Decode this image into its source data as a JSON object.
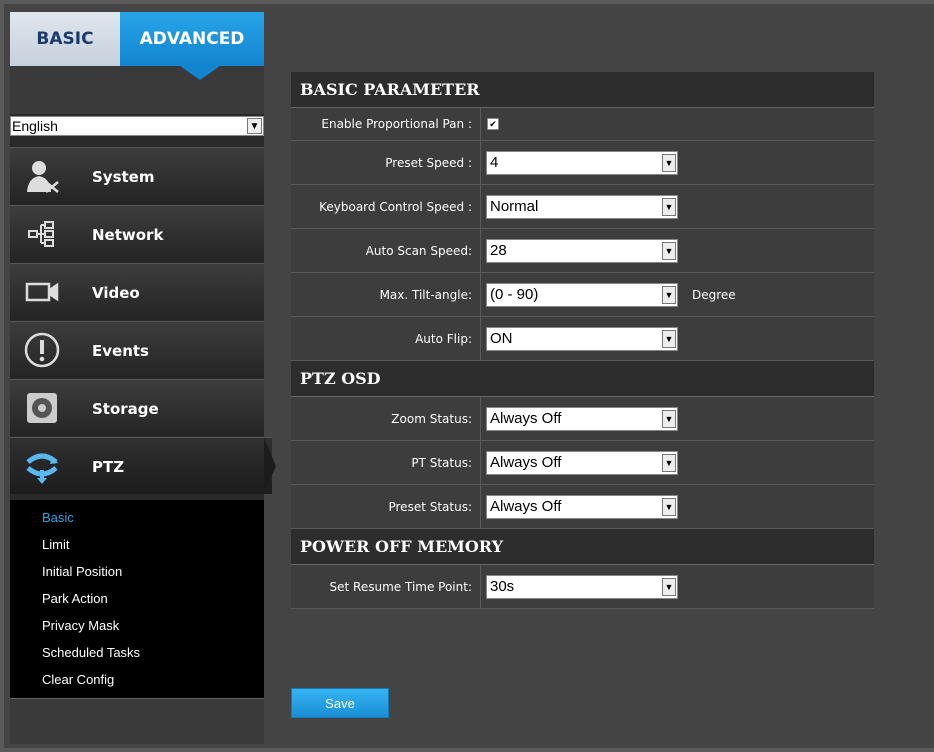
{
  "tabs": {
    "basic": "BASIC",
    "advanced": "ADVANCED"
  },
  "language": {
    "selected": "English"
  },
  "menu": [
    {
      "label": "System",
      "icon": "user-tools-icon"
    },
    {
      "label": "Network",
      "icon": "network-icon"
    },
    {
      "label": "Video",
      "icon": "video-camera-icon"
    },
    {
      "label": "Events",
      "icon": "alert-icon"
    },
    {
      "label": "Storage",
      "icon": "storage-disk-icon"
    },
    {
      "label": "PTZ",
      "icon": "ptz-icon"
    }
  ],
  "submenu": [
    "Basic",
    "Limit",
    "Initial Position",
    "Park Action",
    "Privacy Mask",
    "Scheduled Tasks",
    "Clear Config"
  ],
  "sections": {
    "basic_parameter": {
      "title": "BASIC PARAMETER",
      "enable_pan_label": "Enable Proportional Pan :",
      "enable_pan_checked": "✔",
      "preset_speed_label": "Preset Speed :",
      "preset_speed_value": "4",
      "keyboard_speed_label": "Keyboard Control Speed :",
      "keyboard_speed_value": "Normal",
      "auto_scan_label": "Auto Scan Speed:",
      "auto_scan_value": "28",
      "tilt_label": "Max. Tilt-angle:",
      "tilt_value": "(0 - 90)",
      "tilt_unit": "Degree",
      "auto_flip_label": "Auto Flip:",
      "auto_flip_value": "ON"
    },
    "ptz_osd": {
      "title": "PTZ OSD",
      "zoom_label": "Zoom Status:",
      "zoom_value": "Always Off",
      "pt_label": "PT Status:",
      "pt_value": "Always Off",
      "preset_label": "Preset Status:",
      "preset_value": "Always Off"
    },
    "power_off_memory": {
      "title": "POWER OFF MEMORY",
      "resume_label": "Set Resume Time Point:",
      "resume_value": "30s"
    }
  },
  "save_label": "Save",
  "colors": {
    "accent": "#1384cf",
    "active_sub": "#2aa3e6"
  }
}
